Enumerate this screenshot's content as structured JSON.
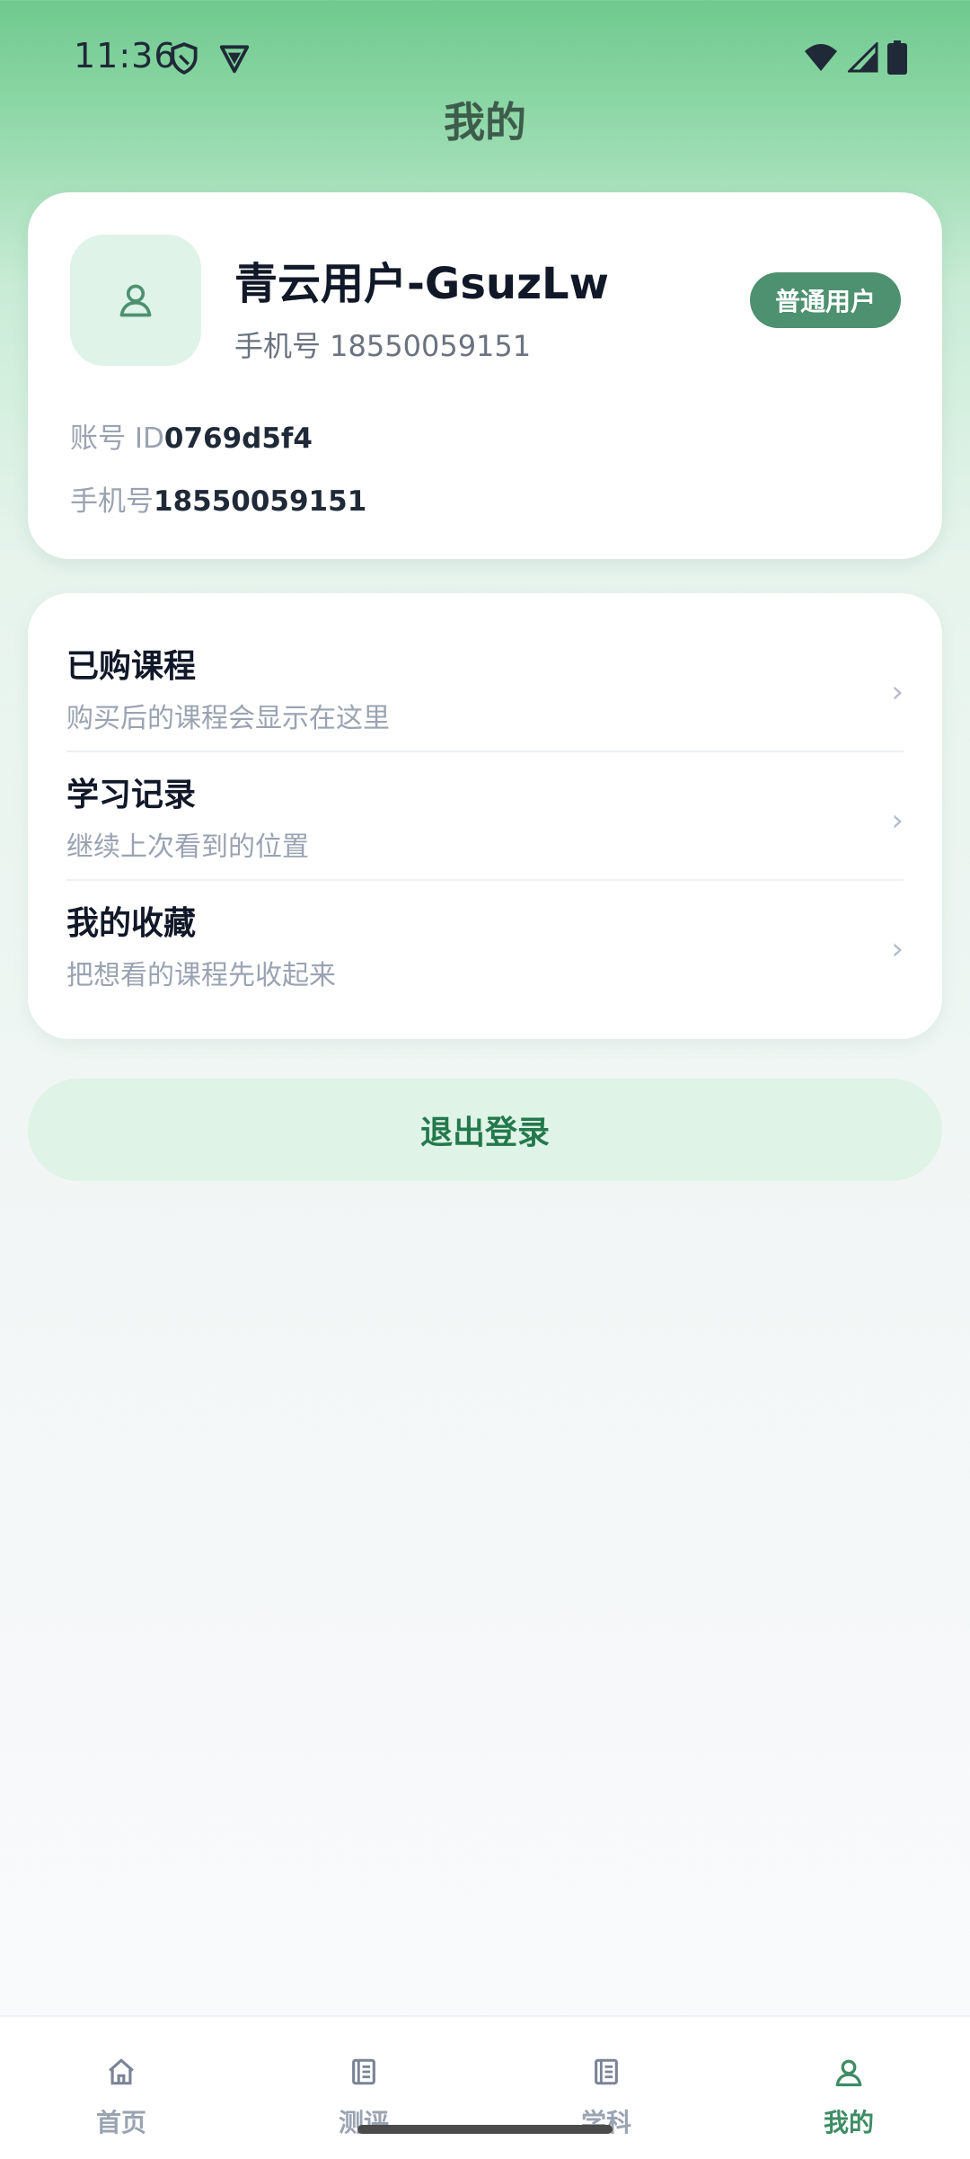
{
  "status_bar": {
    "time": "11:36"
  },
  "header": {
    "title": "我的"
  },
  "profile": {
    "name": "青云用户-GsuzLw",
    "phone_line": "手机号 18550059151",
    "badge": "普通用户",
    "account_id_label": "账号 ID",
    "account_id_value": "0769d5f4",
    "phone_label": "手机号",
    "phone_value": "18550059151"
  },
  "menu": {
    "items": [
      {
        "title": "已购课程",
        "subtitle": "购买后的课程会显示在这里"
      },
      {
        "title": "学习记录",
        "subtitle": "继续上次看到的位置"
      },
      {
        "title": "我的收藏",
        "subtitle": "把想看的课程先收起来"
      }
    ]
  },
  "logout_label": "退出登录",
  "bottom_nav": {
    "items": [
      {
        "label": "首页",
        "icon": "home-icon"
      },
      {
        "label": "测评",
        "icon": "list-icon"
      },
      {
        "label": "学科",
        "icon": "list-icon"
      },
      {
        "label": "我的",
        "icon": "user-icon"
      }
    ],
    "active_index": 3
  },
  "colors": {
    "accent": "#4e9171",
    "accent_dark": "#23784c",
    "logout_bg": "#dff3e6"
  }
}
